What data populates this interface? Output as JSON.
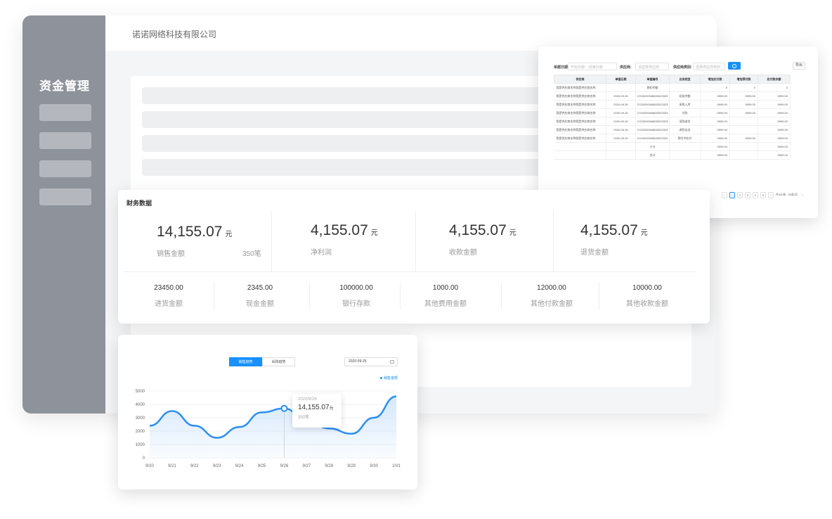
{
  "sidebar": {
    "title": "资金管理"
  },
  "header": {
    "company": "诺诺网络科技有限公司"
  },
  "table_panel": {
    "filters": {
      "date_label": "单据日期:",
      "start_placeholder": "开始日期",
      "end_placeholder": "结束日期",
      "supplier_label": "供应商:",
      "supplier_placeholder": "请选择供应商",
      "supplier_type_label": "供应商类别:",
      "supplier_type_placeholder": "选择供应商类别",
      "export_label": "导出"
    },
    "columns": [
      "供应商",
      "单据日期",
      "单据编号",
      "业务类型",
      "增加应付款",
      "增加预付款",
      "应付款余额"
    ],
    "rows": [
      [
        "我是供应商名称我是供应商名称",
        "",
        "期初余额",
        "",
        "0",
        "0",
        "0"
      ],
      [
        "我是供应商名称我是供应商名称",
        "2020-09-30",
        "CG20200948833323323",
        "初始余额",
        "5999.00",
        "5999.00",
        "5999.00"
      ],
      [
        "我是供应商名称我是供应商名称",
        "2020-09-30",
        "CG20200948833323323",
        "采购入库",
        "5999.00",
        "5999.00",
        "5999.00"
      ],
      [
        "我是供应商名称我是供应商名称",
        "2020-09-30",
        "CG20200948833323323",
        "付款",
        "5999.00",
        "5999.00",
        "5999.00"
      ],
      [
        "我是供应商名称我是供应商名称",
        "2020-09-30",
        "CG20200948833323323",
        "采购退货",
        "5999.00",
        "",
        "5999.00"
      ],
      [
        "我是供应商名称我是供应商名称",
        "2020-09-30",
        "CG20200948833323323",
        "调货出出",
        "5999.00",
        "",
        "5999.00"
      ],
      [
        "我是供应商名称我是供应商名称",
        "2020-09-30",
        "CG20200948833323323",
        "预付冲应付",
        "5999.00",
        "5999.00",
        "5999.00"
      ],
      [
        "",
        "",
        "小计",
        "",
        "5999.00",
        "",
        "5999.00"
      ],
      [
        "",
        "",
        "合计",
        "",
        "5999.00",
        "",
        "5999.00"
      ]
    ],
    "pager": {
      "pages": [
        "1",
        "2",
        "3",
        "4",
        "5"
      ],
      "active": "1",
      "total": "共400条",
      "page_size": "50条/页"
    }
  },
  "finance": {
    "title": "财务数据",
    "big_stats": [
      {
        "value": "14,155.07",
        "unit": "元",
        "label": "销售金额",
        "extra": "350笔"
      },
      {
        "value": "4,155.07",
        "unit": "元",
        "label": "净利润"
      },
      {
        "value": "4,155.07",
        "unit": "元",
        "label": "收款金额"
      },
      {
        "value": "4,155.07",
        "unit": "元",
        "label": "退货金额"
      }
    ],
    "small_stats": [
      {
        "value": "23450.00",
        "label": "进货金额"
      },
      {
        "value": "2345.00",
        "label": "现金金额"
      },
      {
        "value": "100000.00",
        "label": "银行存款"
      },
      {
        "value": "1000.00",
        "label": "其他费用金额"
      },
      {
        "value": "12000.00",
        "label": "其他付款金额"
      },
      {
        "value": "10000.00",
        "label": "其他收款金额"
      }
    ]
  },
  "chart_panel": {
    "tabs": [
      "销售趋势",
      "采购趋势"
    ],
    "active_tab": "销售趋势",
    "date_value": "2020-09-26",
    "tooltip": {
      "date": "2020/9/26",
      "value": "14,155.07",
      "unit": "元",
      "count": "350笔"
    }
  },
  "chart_data": {
    "type": "area",
    "x": [
      "9/20",
      "9/21",
      "9/22",
      "9/23",
      "9/24",
      "9/25",
      "9/26",
      "9/27",
      "9/28",
      "9/29",
      "9/30",
      "10/1"
    ],
    "series": [
      {
        "name": "销售金额",
        "values": [
          2400,
          3500,
          2400,
          1500,
          2300,
          3400,
          3700,
          2800,
          2200,
          1800,
          3000,
          4600
        ]
      }
    ],
    "yticks": [
      0,
      1000,
      2000,
      3000,
      4000,
      5000
    ],
    "ylim": [
      0,
      5000
    ],
    "highlight_index": 6,
    "legend_position": "top-right",
    "grid": true,
    "colors": {
      "line": "#2b8ff2",
      "fill": "#cfe5fb"
    }
  }
}
